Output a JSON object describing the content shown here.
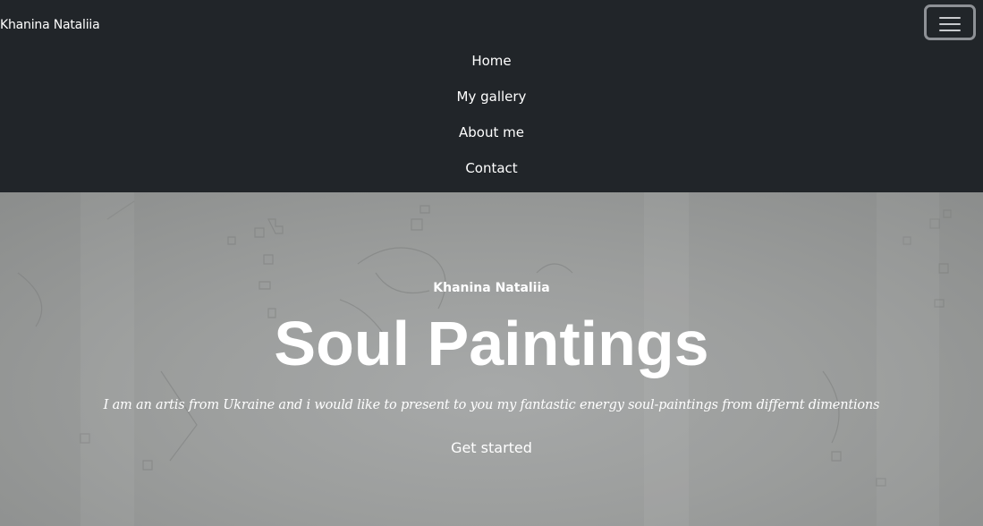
{
  "navbar": {
    "brand": "Khanina Nataliia",
    "toggler_icon": "hamburger-menu-icon",
    "items": [
      {
        "label": "Home"
      },
      {
        "label": "My gallery"
      },
      {
        "label": "About me"
      },
      {
        "label": "Contact"
      }
    ],
    "background": "#212529"
  },
  "hero": {
    "subtitle": "Khanina Nataliia",
    "title": "Soul Paintings",
    "text": "I am an artis from Ukraine and i would like to present to you my fantastic energy soul-paintings from differnt dimentions",
    "cta_label": "Get started"
  }
}
